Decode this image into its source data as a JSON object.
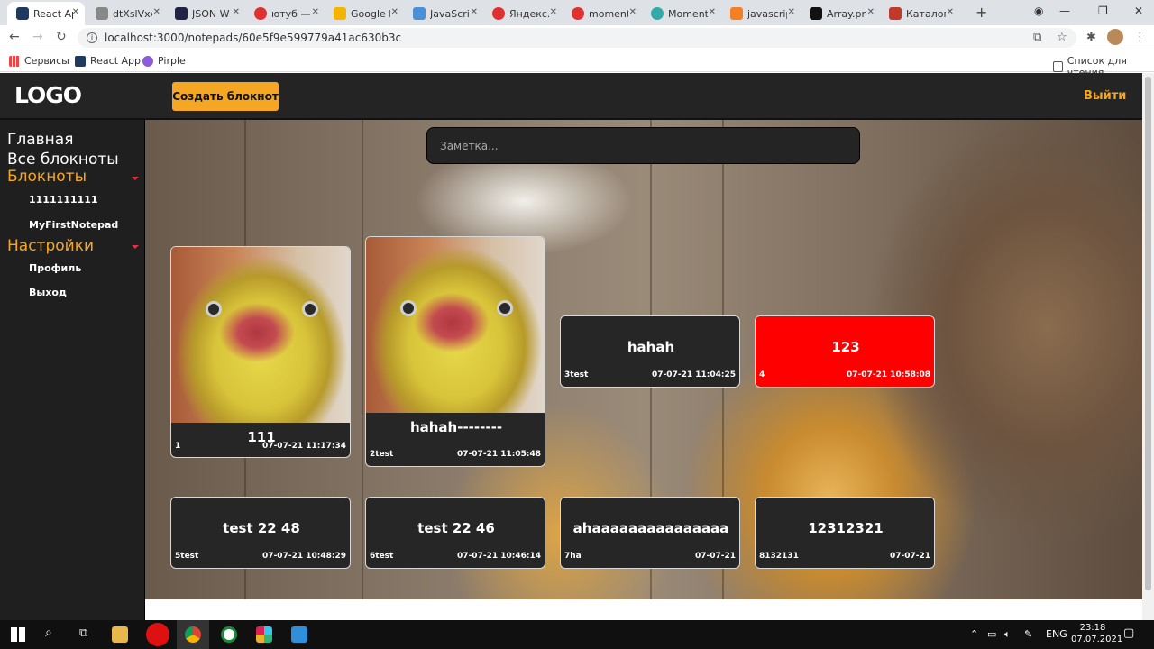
{
  "browser": {
    "tabs": [
      {
        "label": "React App",
        "color": "#1e3a5f",
        "active": true
      },
      {
        "label": "dtXslVxA",
        "color": "#888888"
      },
      {
        "label": "JSON W",
        "color": "#222244"
      },
      {
        "label": "ютуб —",
        "color": "#e03030"
      },
      {
        "label": "Google К",
        "color": "#f4b400"
      },
      {
        "label": "JavaScri",
        "color": "#4a90d9"
      },
      {
        "label": "Яндекс.Л",
        "color": "#e03030"
      },
      {
        "label": "moment",
        "color": "#e03030"
      },
      {
        "label": "Moment",
        "color": "#3aa"
      },
      {
        "label": "javascrip",
        "color": "#f48024"
      },
      {
        "label": "Array.pro",
        "color": "#111111"
      },
      {
        "label": "Каталог",
        "color": "#c0392b"
      }
    ],
    "url": "localhost:3000/notepads/60e5f9e599779a41ac630b3c",
    "bookmarks": [
      {
        "label": "Сервисы",
        "color": "#e44"
      },
      {
        "label": "React App",
        "color": "#1e3a5f"
      },
      {
        "label": "Pirple",
        "color": "#8e5cd9"
      }
    ],
    "reading_list": "Список для чтения"
  },
  "header": {
    "logo": "LOGO",
    "create_button": "Создать блокнот",
    "logout": "Выйти"
  },
  "sidebar": {
    "home": "Главная",
    "all_notepads": "Все блокноты",
    "notepads_section": "Блокноты",
    "notepads": [
      "1111111111",
      "MyFirstNotepad"
    ],
    "settings_section": "Настройки",
    "settings": [
      "Профиль",
      "Выход"
    ]
  },
  "search": {
    "placeholder": "Заметка..."
  },
  "notes": [
    {
      "title": "111",
      "left": "1",
      "date": "07-07-21 11:17:34",
      "image": true
    },
    {
      "title": "hahah--------",
      "left": "2test",
      "date": "07-07-21 11:05:48",
      "image": true
    },
    {
      "title": "hahah",
      "left": "3test",
      "date": "07-07-21 11:04:25"
    },
    {
      "title": "123",
      "left": "4",
      "date": "07-07-21 10:58:08",
      "color": "#ff0000"
    },
    {
      "title": "test 22 48",
      "left": "5test",
      "date": "07-07-21 10:48:29"
    },
    {
      "title": "test 22 46",
      "left": "6test",
      "date": "07-07-21 10:46:14"
    },
    {
      "title": "ahaaaaaaaaaaaaaaa",
      "left": "7ha",
      "date": "07-07-21"
    },
    {
      "title": "12312321",
      "left": "8132131",
      "date": "07-07-21"
    }
  ],
  "taskbar": {
    "lang": "ENG",
    "time": "23:18",
    "date": "07.07.2021"
  }
}
